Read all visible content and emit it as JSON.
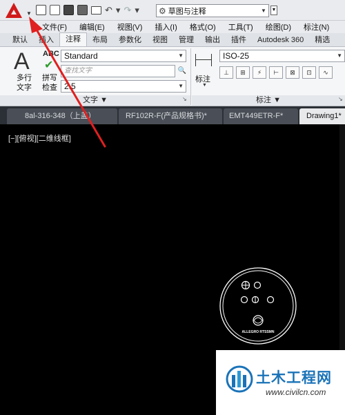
{
  "qat": {
    "workspace": "草图与注释"
  },
  "menu": [
    "文件(F)",
    "编辑(E)",
    "视图(V)",
    "插入(I)",
    "格式(O)",
    "工具(T)",
    "绘图(D)",
    "标注(N)"
  ],
  "ribbon_tabs": [
    "默认",
    "插入",
    "注释",
    "布局",
    "参数化",
    "视图",
    "管理",
    "输出",
    "插件",
    "Autodesk 360",
    "精选"
  ],
  "ribbon": {
    "big_glyph": "A",
    "mtext_line1": "多行",
    "mtext_line2": "文字",
    "spell_glyph": "ABC",
    "spell_line1": "拼写",
    "spell_line2": "检查",
    "text_style": "Standard",
    "find_placeholder": "查找文字",
    "text_height": "2.5",
    "text_panel": "文字 ▼",
    "dim_label": "标注",
    "dim_style": "ISO-25",
    "dim_panel": "标注 ▼"
  },
  "doc_tabs": [
    "8al-316-348（上盖）",
    "RF102R-F(产品规格书)*",
    "EMT449ETR-F*",
    "Drawing1*"
  ],
  "viewport": {
    "label": "[−][俯视][二维线框]",
    "part_text": "ALLEGRO RTSSMN"
  },
  "watermark": {
    "title": "土木工程网",
    "url": "www.civilcn.com"
  },
  "colors": {
    "accent_red": "#d11a1a",
    "watermark_blue": "#1a73b8",
    "canvas": "#000000"
  }
}
